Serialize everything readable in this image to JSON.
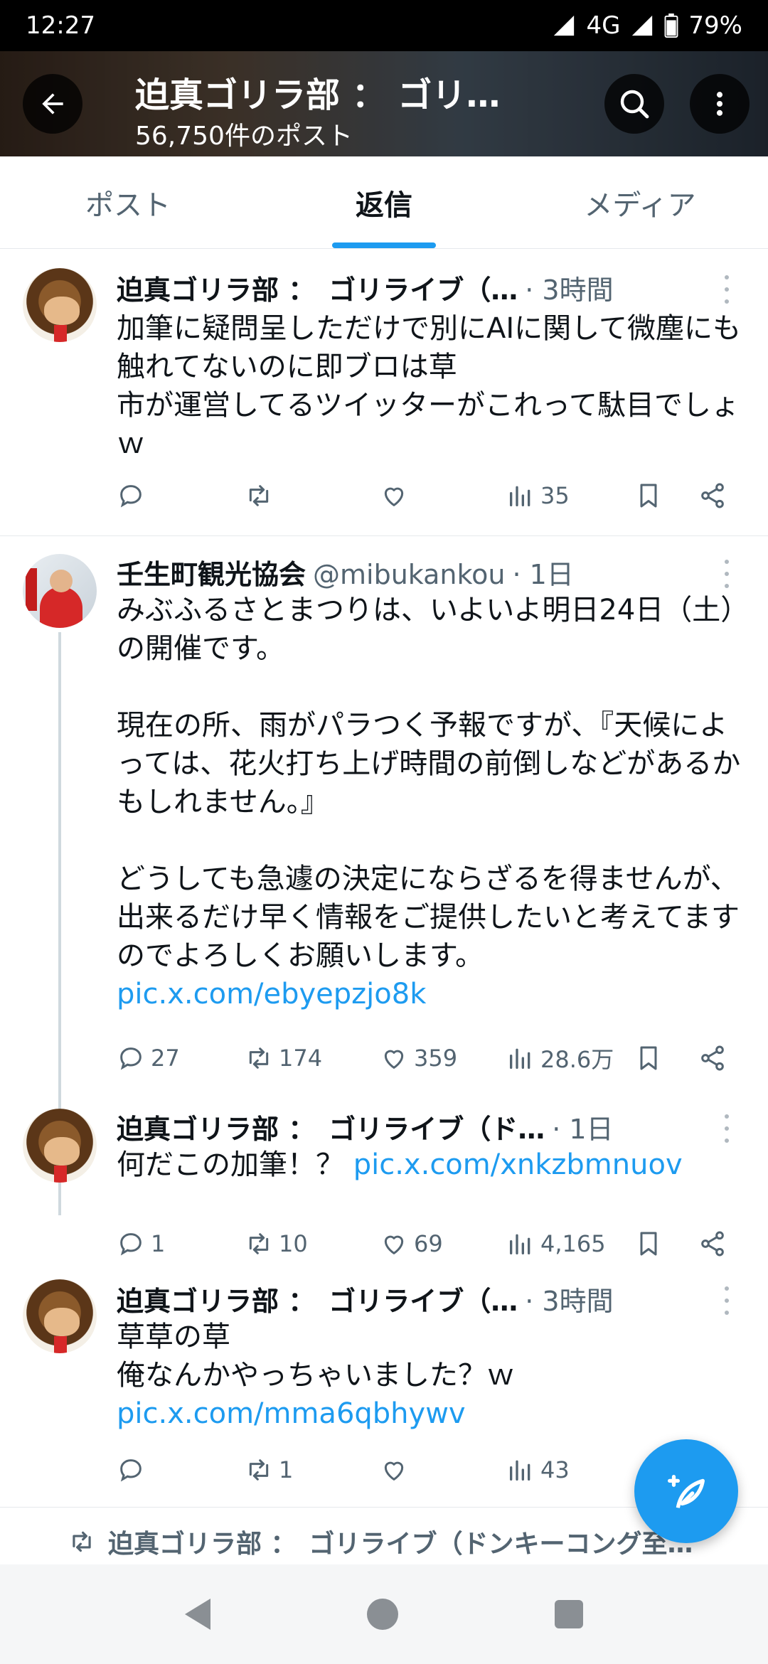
{
  "status_bar": {
    "time": "12:27",
    "network": "4G",
    "battery": "79%"
  },
  "header": {
    "title": "迫真ゴリラ部 ： ゴリ…",
    "subtitle": "56,750件のポスト"
  },
  "tabs": [
    {
      "label": "ポスト",
      "active": false
    },
    {
      "label": "返信",
      "active": true
    },
    {
      "label": "メディア",
      "active": false
    }
  ],
  "tweets": [
    {
      "name": "迫真ゴリラ部 ：　ゴリライブ（…",
      "handle": "",
      "time": "· 3時間",
      "text": "加筆に疑問呈しただけで別にAIに関して微塵にも触れてないのに即ブロは草\n市が運営してるツイッターがこれって駄目でしょｗ",
      "link": "",
      "replies": "",
      "reposts": "",
      "likes": "",
      "views": "35"
    },
    {
      "name": "壬生町観光協会",
      "handle": "@mibukankou",
      "time": "· 1日",
      "text": "みぶふるさとまつりは、いよいよ明日24日（土）の開催です。\n\n現在の所、雨がパラつく予報ですが、『天候によっては、花火打ち上げ時間の前倒しなどがあるかもしれません。』\n\nどうしても急遽の決定にならざるを得ませんが、出来るだけ早く情報をご提供したいと考えてますのでよろしくお願いします。",
      "link": "pic.x.com/ebyepzjo8k",
      "replies": "27",
      "reposts": "174",
      "likes": "359",
      "views": "28.6万"
    },
    {
      "name": "迫真ゴリラ部 ：　ゴリライブ（ド…",
      "handle": "",
      "time": "· 1日",
      "text": "何だこの加筆！？",
      "link": "pic.x.com/xnkzbmnuov",
      "replies": "1",
      "reposts": "10",
      "likes": "69",
      "views": "4,165"
    },
    {
      "name": "迫真ゴリラ部 ：　ゴリライブ（…",
      "handle": "",
      "time": "· 3時間",
      "text": "草草の草\n俺なんかやっちゃいました？ｗ",
      "link": "pic.x.com/mma6qbhywv",
      "replies": "",
      "reposts": "1",
      "likes": "",
      "views": "43"
    }
  ],
  "repost_banner": {
    "text": "迫真ゴリラ部 ：　ゴリライブ（ドンキーコング至…"
  },
  "colors": {
    "accent": "#1d9bf0",
    "text": "#0f1419",
    "muted": "#536471"
  },
  "icons": {
    "back": "arrow-left-icon",
    "search": "search-icon",
    "more": "more-vertical-icon",
    "reply": "reply-icon",
    "repost": "repost-icon",
    "like": "heart-icon",
    "views": "views-icon",
    "bookmark": "bookmark-icon",
    "share": "share-icon",
    "compose": "compose-icon"
  }
}
